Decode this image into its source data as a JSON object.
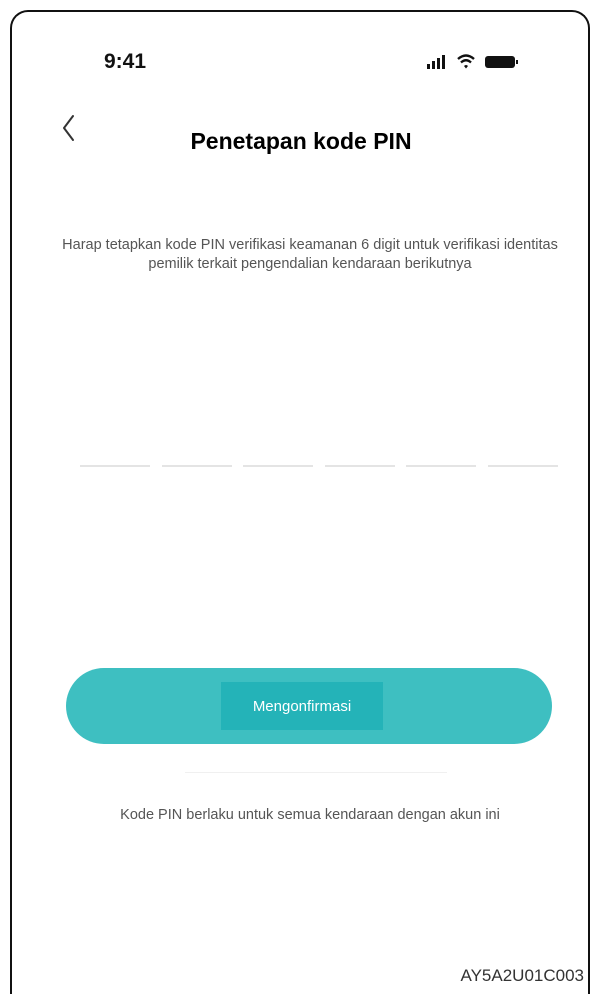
{
  "status_bar": {
    "time": "9:41",
    "signal_icon": "signal-bars-icon",
    "wifi_icon": "wifi-icon",
    "battery_icon": "battery-icon"
  },
  "header": {
    "back_icon": "chevron-left-icon",
    "title": "Penetapan kode PIN"
  },
  "main": {
    "description": "Harap tetapkan kode PIN verifikasi keamanan 6 digit untuk verifikasi identitas pemilik terkait pengendalian kendaraan berikutnya",
    "pin_length": 6
  },
  "actions": {
    "confirm_label": "Mengonfirmasi"
  },
  "footer": {
    "note": "Kode PIN berlaku untuk semua kendaraan dengan akun ini"
  },
  "document_code": "AY5A2U01C003",
  "colors": {
    "accent": "#3ebfc1",
    "accent_dark": "#24b3b8",
    "text_muted": "#555555"
  }
}
